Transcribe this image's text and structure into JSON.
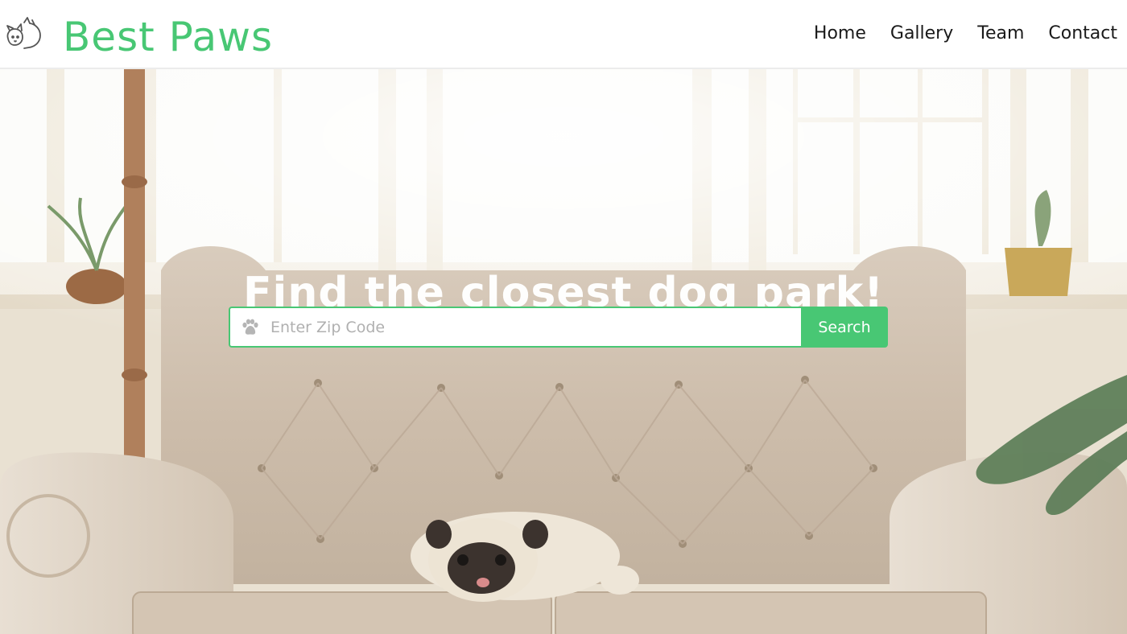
{
  "brand": {
    "name": "Best Paws",
    "logo_icon": "cat-dog-logo-icon",
    "color": "#48c774"
  },
  "nav": {
    "items": [
      {
        "label": "Home"
      },
      {
        "label": "Gallery"
      },
      {
        "label": "Team"
      },
      {
        "label": "Contact"
      }
    ]
  },
  "hero": {
    "title": "Find the closest dog park!",
    "background": "pug-on-tufted-sofa-photo"
  },
  "search": {
    "placeholder": "Enter Zip Code",
    "value": "",
    "icon": "paw-icon",
    "button_label": "Search",
    "accent": "#48c774"
  }
}
